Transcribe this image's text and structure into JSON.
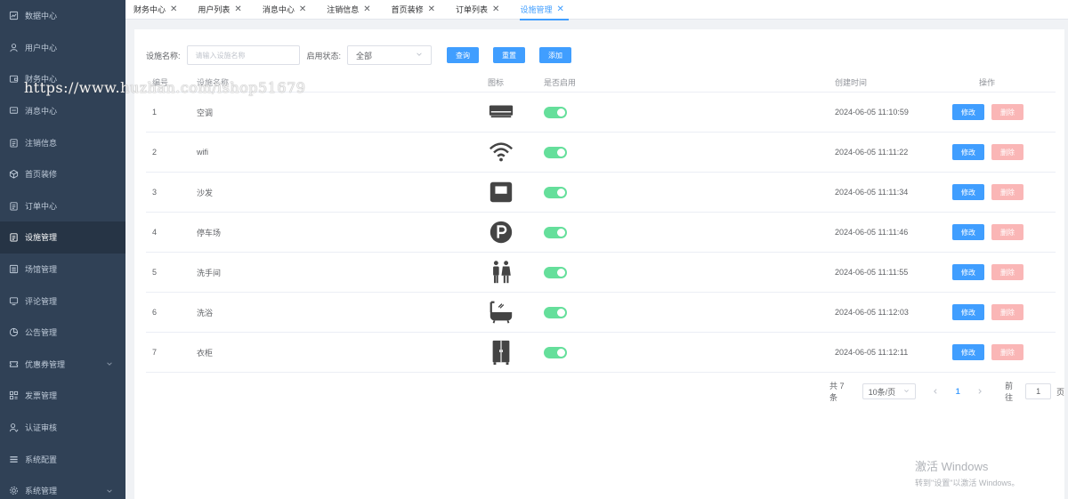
{
  "sidebar": {
    "items": [
      {
        "label": "数据中心",
        "icon": "chart-icon"
      },
      {
        "label": "用户中心",
        "icon": "user-icon"
      },
      {
        "label": "财务中心",
        "icon": "wallet-icon"
      },
      {
        "label": "消息中心",
        "icon": "message-icon"
      },
      {
        "label": "注销信息",
        "icon": "clipboard-icon"
      },
      {
        "label": "首页装修",
        "icon": "cube-icon"
      },
      {
        "label": "订单中心",
        "icon": "clipboard-icon"
      },
      {
        "label": "设施管理",
        "icon": "clipboard-icon"
      },
      {
        "label": "场馆管理",
        "icon": "list-icon"
      },
      {
        "label": "评论管理",
        "icon": "monitor-icon"
      },
      {
        "label": "公告管理",
        "icon": "pie-icon"
      },
      {
        "label": "优惠券管理",
        "icon": "ticket-icon"
      },
      {
        "label": "发票管理",
        "icon": "grid-icon"
      },
      {
        "label": "认证审核",
        "icon": "user-check-icon"
      },
      {
        "label": "系统配置",
        "icon": "menu-icon"
      },
      {
        "label": "系统管理",
        "icon": "gear-icon"
      }
    ]
  },
  "tabs": [
    {
      "label": "财务中心"
    },
    {
      "label": "用户列表"
    },
    {
      "label": "消息中心"
    },
    {
      "label": "注销信息"
    },
    {
      "label": "首页装修"
    },
    {
      "label": "订单列表"
    },
    {
      "label": "设施管理"
    }
  ],
  "tab_close": "✕",
  "filters": {
    "name_label": "设施名称:",
    "name_placeholder": "请输入设施名称",
    "status_label": "启用状态:",
    "status_value": "全部",
    "search_btn": "查询",
    "reset_btn": "重置",
    "add_btn": "添加"
  },
  "table": {
    "headers": {
      "id": "编号",
      "name": "设施名称",
      "icon": "图标",
      "enabled": "是否启用",
      "created": "创建时间",
      "ops": "操作"
    },
    "edit_label": "修改",
    "delete_label": "删除",
    "rows": [
      {
        "id": "1",
        "name": "空调",
        "icon": "air-conditioner-icon",
        "enabled": true,
        "created": "2024-06-05 11:10:59"
      },
      {
        "id": "2",
        "name": "wifi",
        "icon": "wifi-icon",
        "enabled": true,
        "created": "2024-06-05 11:11:22"
      },
      {
        "id": "3",
        "name": "沙发",
        "icon": "sofa-icon",
        "enabled": true,
        "created": "2024-06-05 11:11:34"
      },
      {
        "id": "4",
        "name": "停车场",
        "icon": "parking-icon",
        "enabled": true,
        "created": "2024-06-05 11:11:46"
      },
      {
        "id": "5",
        "name": "洗手间",
        "icon": "restroom-icon",
        "enabled": true,
        "created": "2024-06-05 11:11:55"
      },
      {
        "id": "6",
        "name": "洗浴",
        "icon": "bathtub-icon",
        "enabled": true,
        "created": "2024-06-05 11:12:03"
      },
      {
        "id": "7",
        "name": "衣柜",
        "icon": "wardrobe-icon",
        "enabled": true,
        "created": "2024-06-05 11:12:11"
      }
    ]
  },
  "pagination": {
    "total": "共 7 条",
    "page_size": "10条/页",
    "current": "1",
    "goto_prefix": "前往",
    "goto_value": "1",
    "goto_suffix": "页"
  },
  "watermark": "https://www.huzhan.com/ishop51679",
  "windows_activation": {
    "title": "激活 Windows",
    "subtitle": "转到\"设置\"以激活 Windows。"
  },
  "colors": {
    "sidebar_bg": "#304156",
    "sidebar_active": "#263445",
    "primary": "#409eff",
    "danger_light": "#fab6b6",
    "switch_on": "#13ce66"
  }
}
